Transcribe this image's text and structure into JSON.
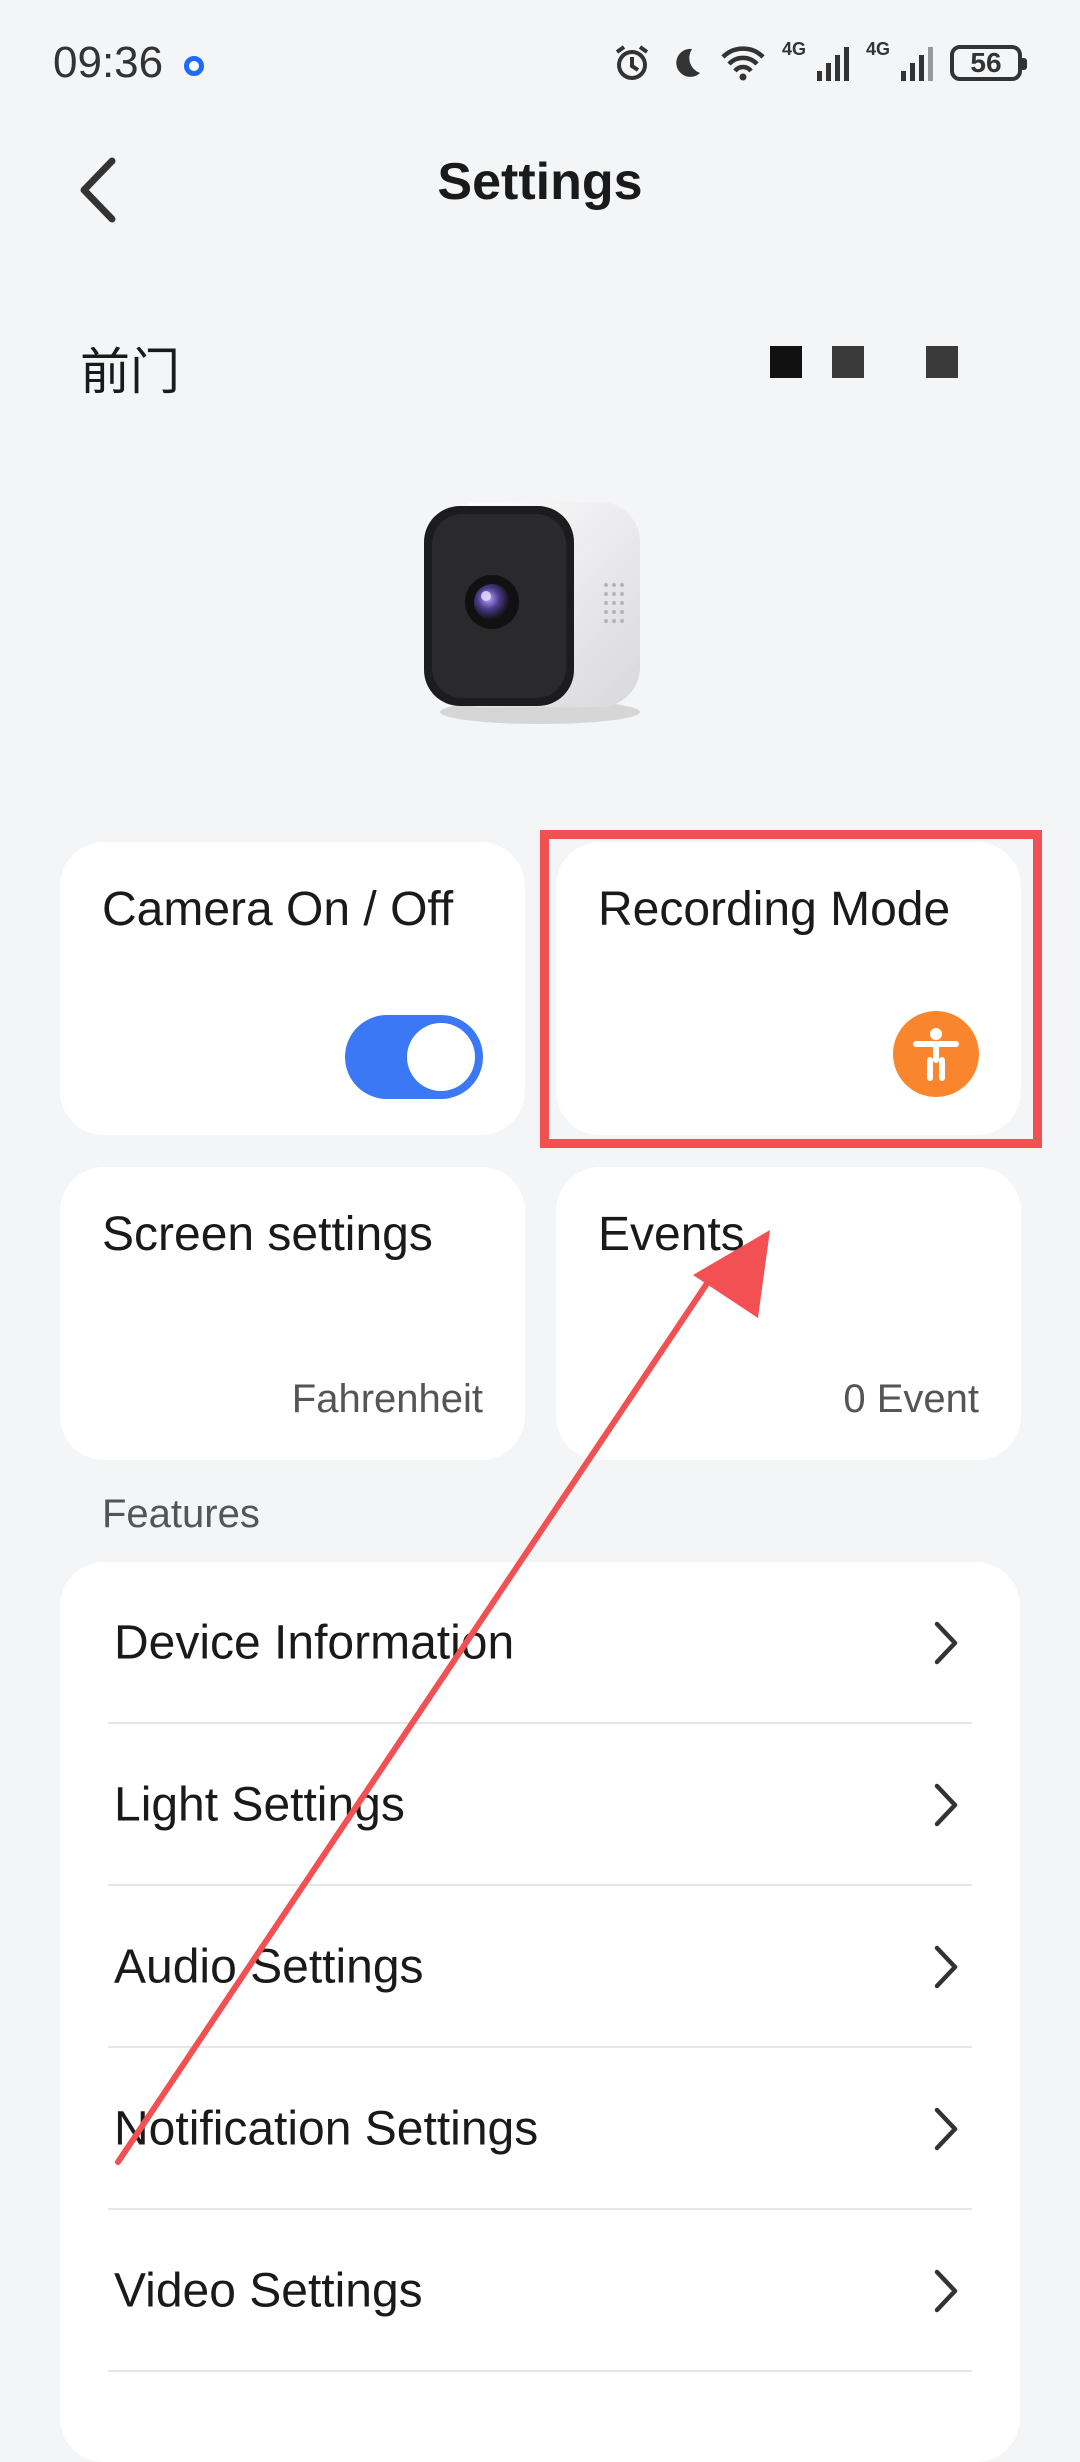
{
  "status_bar": {
    "time": "09:36",
    "network_1": "4G",
    "network_2": "4G",
    "battery": "56"
  },
  "header": {
    "title": "Settings"
  },
  "device": {
    "name": "前门"
  },
  "cards": {
    "camera_power": {
      "label": "Camera On / Off",
      "enabled": true
    },
    "recording_mode": {
      "label": "Recording Mode"
    },
    "screen_settings": {
      "label": "Screen settings",
      "value": "Fahrenheit"
    },
    "events": {
      "label": "Events",
      "value": "0 Event"
    }
  },
  "features": {
    "heading": "Features",
    "items": [
      {
        "label": "Device Information"
      },
      {
        "label": "Light Settings"
      },
      {
        "label": "Audio Settings"
      },
      {
        "label": "Notification Settings"
      },
      {
        "label": "Video Settings"
      }
    ]
  },
  "colors": {
    "accent_blue": "#3b78f6",
    "badge_orange": "#f9862c",
    "annotation_red": "#f25052",
    "background": "#f4f5f7"
  }
}
